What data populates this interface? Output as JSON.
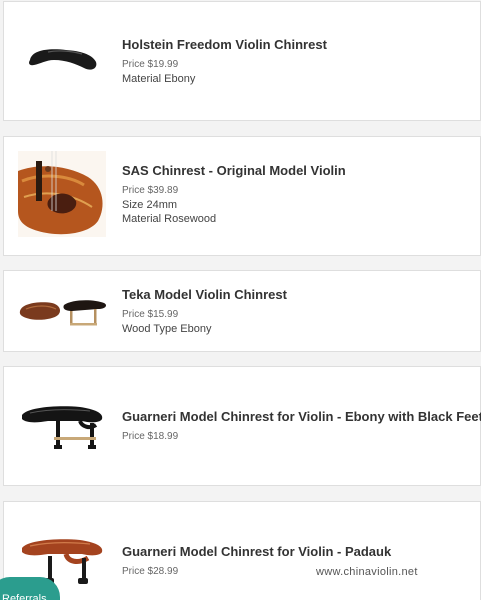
{
  "products": [
    {
      "title": "Holstein Freedom Violin Chinrest",
      "price": "Price $19.99",
      "attributes": [
        "Material Ebony"
      ],
      "icon": "chinrest-ebony-image"
    },
    {
      "title": "SAS Chinrest - Original Model Violin",
      "price": "Price $39.89",
      "attributes": [
        "Size 24mm",
        "Material Rosewood"
      ],
      "icon": "violin-chinrest-photo"
    },
    {
      "title": "Teka Model Violin Chinrest",
      "price": "Price $15.99",
      "attributes": [
        "Wood Type Ebony"
      ],
      "icon": "teka-chinrest-image"
    },
    {
      "title": "Guarneri Model Chinrest for Violin - Ebony with Black Feet",
      "price": "Price $18.99",
      "attributes": [],
      "icon": "guarneri-ebony-chinrest-image"
    },
    {
      "title": "Guarneri Model Chinrest for Violin - Padauk",
      "price": "Price $28.99",
      "attributes": [],
      "icon": "guarneri-padauk-chinrest-image"
    }
  ],
  "watermark": "www.chinaviolin.net",
  "referrals_label": "Referrals",
  "colors": {
    "ebony": "#1a1a1a",
    "rosewood": "#7a3a1e",
    "padauk": "#a4431f",
    "accent": "#2b9d8e"
  }
}
